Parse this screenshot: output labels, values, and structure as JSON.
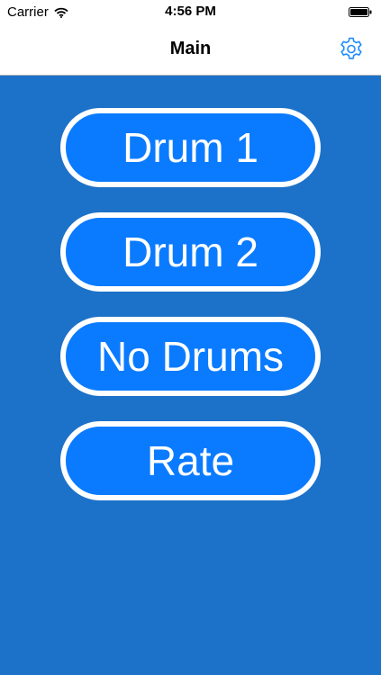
{
  "status_bar": {
    "carrier": "Carrier",
    "time": "4:56 PM"
  },
  "nav": {
    "title": "Main",
    "settings_icon": "gear-icon"
  },
  "menu": {
    "buttons": [
      {
        "label": "Drum 1"
      },
      {
        "label": "Drum 2"
      },
      {
        "label": "No Drums"
      },
      {
        "label": "Rate"
      }
    ]
  },
  "colors": {
    "background": "#1c72c9",
    "button_fill": "#0a7bff",
    "button_border": "#ffffff",
    "accent": "#1a8cff"
  }
}
